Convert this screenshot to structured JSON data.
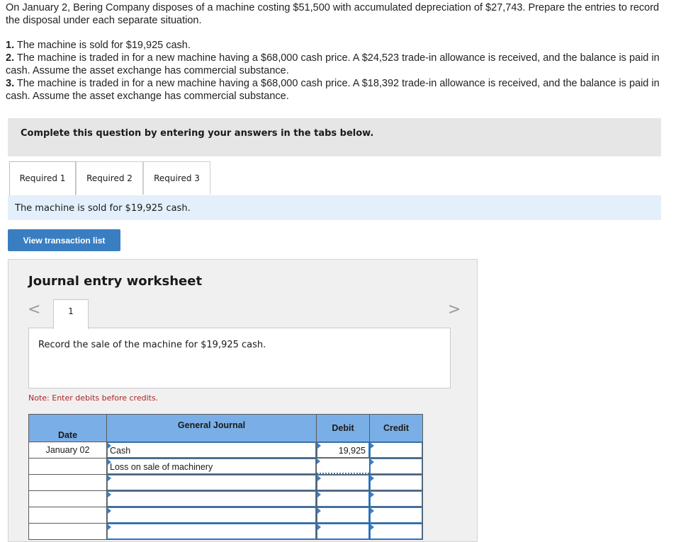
{
  "question": {
    "intro": "On January 2, Bering Company disposes of a machine costing $51,500 with accumulated depreciation of $27,743. Prepare the entries to record the disposal under each separate situation.",
    "items": [
      {
        "num": "1.",
        "text": " The machine is sold for $19,925 cash."
      },
      {
        "num": "2.",
        "text": " The machine is traded in for a new machine having a $68,000 cash price. A $24,523 trade-in allowance is received, and the balance is paid in cash. Assume the asset exchange has commercial substance."
      },
      {
        "num": "3.",
        "text": " The machine is traded in for a new machine having a $68,000 cash price. A $18,392 trade-in allowance is received, and the balance is paid in cash. Assume the asset exchange has commercial substance."
      }
    ]
  },
  "banner": "Complete this question by entering your answers in the tabs below.",
  "tabs": [
    "Required 1",
    "Required 2",
    "Required 3"
  ],
  "active_tab": "Required 1",
  "info": "The machine is sold for $19,925 cash.",
  "view_button": "View transaction list",
  "worksheet": {
    "title": "Journal entry worksheet",
    "prev_icon": "<",
    "next_icon": ">",
    "page": "1",
    "description": "Record the sale of the machine for $19,925 cash.",
    "note": "Note: Enter debits before credits.",
    "headers": {
      "date": "Date",
      "journal": "General Journal",
      "debit": "Debit",
      "credit": "Credit"
    },
    "rows": [
      {
        "date": "January 02",
        "account": "Cash",
        "debit": "19,925",
        "credit": ""
      },
      {
        "date": "",
        "account": "Loss on sale of machinery",
        "debit": "",
        "credit": ""
      },
      {
        "date": "",
        "account": "",
        "debit": "",
        "credit": ""
      },
      {
        "date": "",
        "account": "",
        "debit": "",
        "credit": ""
      },
      {
        "date": "",
        "account": "",
        "debit": "",
        "credit": ""
      },
      {
        "date": "",
        "account": "",
        "debit": "",
        "credit": ""
      }
    ]
  },
  "colors": {
    "accent": "#3a7ec2",
    "header_blue": "#7aaee6",
    "info_bg": "#e3f0fb",
    "note_red": "#b22222"
  }
}
